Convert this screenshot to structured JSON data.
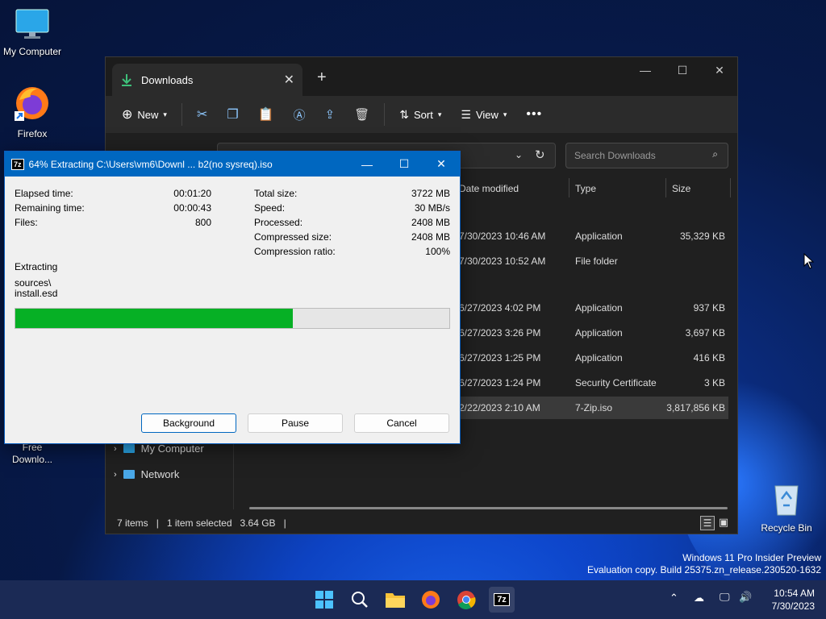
{
  "desktop": {
    "icons": [
      {
        "label": "My Computer"
      },
      {
        "label": "Firefox"
      },
      {
        "label": "Free Downlo..."
      },
      {
        "label": "Recycle Bin"
      }
    ],
    "watermark": {
      "line1": "Windows 11 Pro Insider Preview",
      "line2": "Evaluation copy. Build 25375.zn_release.230520-1632"
    }
  },
  "explorer": {
    "tab_title": "Downloads",
    "toolbar": {
      "new_label": "New",
      "sort_label": "Sort",
      "view_label": "View"
    },
    "search_placeholder": "Search Downloads",
    "columns": {
      "date": "Date modified",
      "type": "Type",
      "size": "Size"
    },
    "rows": [
      {
        "date": "7/30/2023 10:46 AM",
        "type": "Application",
        "size": "35,329 KB"
      },
      {
        "date": "7/30/2023 10:52 AM",
        "type": "File folder",
        "size": ""
      },
      {
        "date": "6/27/2023 4:02 PM",
        "type": "Application",
        "size": "937 KB"
      },
      {
        "date": "6/27/2023 3:26 PM",
        "type": "Application",
        "size": "3,697 KB"
      },
      {
        "date": "6/27/2023 1:25 PM",
        "type": "Application",
        "size": "416 KB"
      },
      {
        "date": "6/27/2023 1:24 PM",
        "type": "Security Certificate",
        "size": "3 KB"
      },
      {
        "date": "2/22/2023 2:10 AM",
        "type": "7-Zip.iso",
        "size": "3,817,856 KB"
      }
    ],
    "nav": {
      "my_computer": "My Computer",
      "network": "Network"
    },
    "status": {
      "items": "7 items",
      "selected": "1 item selected",
      "size": "3.64 GB"
    }
  },
  "dialog": {
    "title": "64% Extracting C:\\Users\\vm6\\Downl ...  b2(no sysreq).iso",
    "left_stats": [
      {
        "label": "Elapsed time:",
        "value": "00:01:20"
      },
      {
        "label": "Remaining time:",
        "value": "00:00:43"
      },
      {
        "label": "Files:",
        "value": "800"
      }
    ],
    "right_stats": [
      {
        "label": "Total size:",
        "value": "3722 MB"
      },
      {
        "label": "Speed:",
        "value": "30 MB/s"
      },
      {
        "label": "Processed:",
        "value": "2408 MB"
      },
      {
        "label": "Compressed size:",
        "value": "2408 MB"
      },
      {
        "label": "Compression ratio:",
        "value": "100%"
      }
    ],
    "action": "Extracting",
    "path_line1": "sources\\",
    "path_line2": "install.esd",
    "progress_fraction": 0.64,
    "buttons": {
      "background": "Background",
      "pause": "Pause",
      "cancel": "Cancel"
    }
  },
  "taskbar": {
    "time": "10:54 AM",
    "date": "7/30/2023"
  }
}
